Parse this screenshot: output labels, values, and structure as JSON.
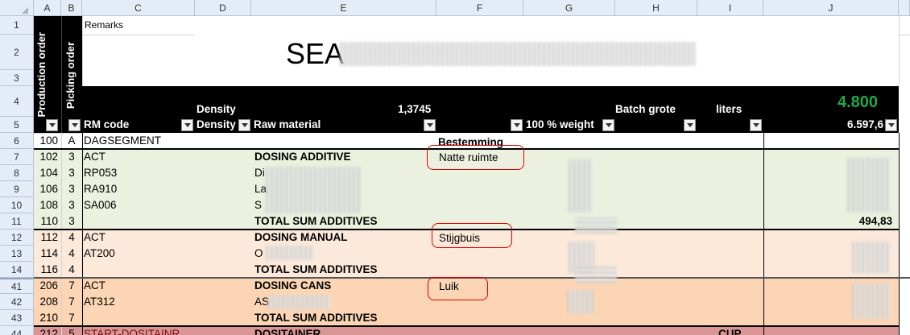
{
  "columns": [
    "A",
    "B",
    "C",
    "D",
    "E",
    "F",
    "G",
    "H",
    "I",
    "J"
  ],
  "row_numbers": [
    "1",
    "2",
    "3",
    "4",
    "5",
    "6",
    "7",
    "8",
    "9",
    "10",
    "11",
    "12",
    "13",
    "14",
    "41",
    "42",
    "43",
    "44"
  ],
  "header": {
    "remarks_label": "Remarks",
    "title": "SEA",
    "production_order_label": "Production order",
    "picking_order_label": "Picking order",
    "density_label": "Density",
    "density_value": "1,3745",
    "batch_label": "Batch grote",
    "liters_label": "liters",
    "batch_value": "4.800",
    "rm_code_label": "RM code",
    "density_col_label": "Density",
    "raw_material_label": "Raw material",
    "weight_label": "100 % weight",
    "total_value": "6.597,6"
  },
  "rows": [
    {
      "a": "100",
      "b": "A",
      "c": "DAGSEGMENT",
      "e": "",
      "f": "Bestemming",
      "j": ""
    },
    {
      "a": "102",
      "b": "3",
      "c": "ACT",
      "e": "DOSING ADDITIVE",
      "f": "Natte ruimte",
      "j": ""
    },
    {
      "a": "104",
      "b": "3",
      "c": "RP053",
      "e": "Di",
      "f": "",
      "j": ""
    },
    {
      "a": "106",
      "b": "3",
      "c": "RA910",
      "e": "La",
      "f": "",
      "j": ""
    },
    {
      "a": "108",
      "b": "3",
      "c": "SA006",
      "e": "S",
      "f": "",
      "j": ""
    },
    {
      "a": "110",
      "b": "3",
      "c": "",
      "e": "TOTAL SUM ADDITIVES",
      "f": "",
      "j": "494,83"
    },
    {
      "a": "112",
      "b": "4",
      "c": "ACT",
      "e": "DOSING MANUAL",
      "f": "Stijgbuis",
      "j": ""
    },
    {
      "a": "114",
      "b": "4",
      "c": "AT200",
      "e": "O",
      "f": "",
      "j": ""
    },
    {
      "a": "116",
      "b": "4",
      "c": "",
      "e": "TOTAL SUM ADDITIVES",
      "f": "",
      "j": ""
    },
    {
      "a": "206",
      "b": "7",
      "c": "ACT",
      "e": "DOSING CANS",
      "f": "Luik",
      "j": ""
    },
    {
      "a": "208",
      "b": "7",
      "c": "AT312",
      "e": "AS",
      "f": "",
      "j": ""
    },
    {
      "a": "210",
      "b": "7",
      "c": "",
      "e": "TOTAL SUM ADDITIVES",
      "f": "",
      "j": ""
    },
    {
      "a": "212",
      "b": "5",
      "c": "START-DOSITAINR",
      "e": "DOSITAINER",
      "f": "",
      "i": "CUP",
      "j": ""
    }
  ]
}
